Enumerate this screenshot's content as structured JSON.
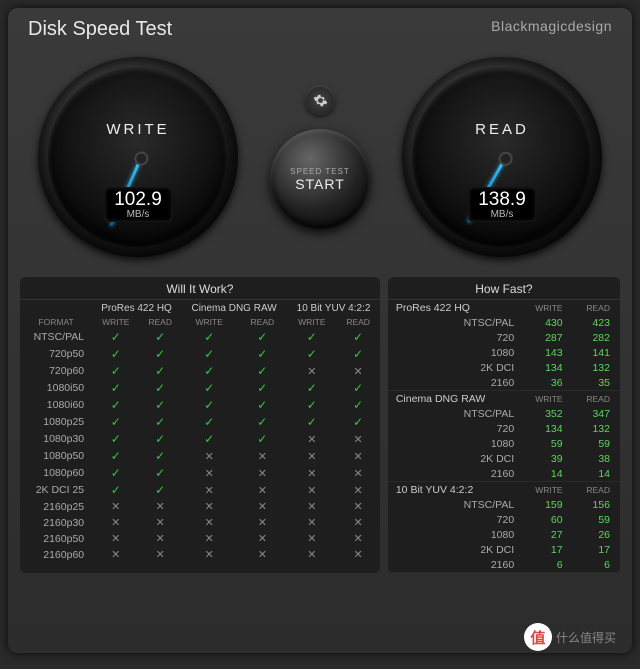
{
  "title": "Disk Speed Test",
  "brand": "Blackmagicdesign",
  "gear_icon": "gear-icon",
  "start": {
    "sub": "SPEED TEST",
    "main": "START"
  },
  "write": {
    "label": "WRITE",
    "value": "102.9",
    "unit": "MB/s",
    "needle_deg": 24
  },
  "read": {
    "label": "READ",
    "value": "138.9",
    "unit": "MB/s",
    "needle_deg": 30
  },
  "will_it_work": {
    "title": "Will It Work?",
    "format_hdr": "FORMAT",
    "codecs": [
      "ProRes 422 HQ",
      "Cinema DNG RAW",
      "10 Bit YUV 4:2:2"
    ],
    "sub": [
      "WRITE",
      "READ"
    ],
    "rows": [
      {
        "fmt": "NTSC/PAL",
        "c": [
          [
            1,
            1
          ],
          [
            1,
            1
          ],
          [
            1,
            1
          ]
        ]
      },
      {
        "fmt": "720p50",
        "c": [
          [
            1,
            1
          ],
          [
            1,
            1
          ],
          [
            1,
            1
          ]
        ]
      },
      {
        "fmt": "720p60",
        "c": [
          [
            1,
            1
          ],
          [
            1,
            1
          ],
          [
            0,
            0
          ]
        ]
      },
      {
        "fmt": "1080i50",
        "c": [
          [
            1,
            1
          ],
          [
            1,
            1
          ],
          [
            1,
            1
          ]
        ]
      },
      {
        "fmt": "1080i60",
        "c": [
          [
            1,
            1
          ],
          [
            1,
            1
          ],
          [
            1,
            1
          ]
        ]
      },
      {
        "fmt": "1080p25",
        "c": [
          [
            1,
            1
          ],
          [
            1,
            1
          ],
          [
            1,
            1
          ]
        ]
      },
      {
        "fmt": "1080p30",
        "c": [
          [
            1,
            1
          ],
          [
            1,
            1
          ],
          [
            0,
            0
          ]
        ]
      },
      {
        "fmt": "1080p50",
        "c": [
          [
            1,
            1
          ],
          [
            0,
            0
          ],
          [
            0,
            0
          ]
        ]
      },
      {
        "fmt": "1080p60",
        "c": [
          [
            1,
            1
          ],
          [
            0,
            0
          ],
          [
            0,
            0
          ]
        ]
      },
      {
        "fmt": "2K DCI 25",
        "c": [
          [
            1,
            1
          ],
          [
            0,
            0
          ],
          [
            0,
            0
          ]
        ]
      },
      {
        "fmt": "2160p25",
        "c": [
          [
            0,
            0
          ],
          [
            0,
            0
          ],
          [
            0,
            0
          ]
        ]
      },
      {
        "fmt": "2160p30",
        "c": [
          [
            0,
            0
          ],
          [
            0,
            0
          ],
          [
            0,
            0
          ]
        ]
      },
      {
        "fmt": "2160p50",
        "c": [
          [
            0,
            0
          ],
          [
            0,
            0
          ],
          [
            0,
            0
          ]
        ]
      },
      {
        "fmt": "2160p60",
        "c": [
          [
            0,
            0
          ],
          [
            0,
            0
          ],
          [
            0,
            0
          ]
        ]
      }
    ]
  },
  "how_fast": {
    "title": "How Fast?",
    "sub": [
      "WRITE",
      "READ"
    ],
    "sections": [
      {
        "name": "ProRes 422 HQ",
        "rows": [
          {
            "fmt": "NTSC/PAL",
            "w": "430",
            "r": "423"
          },
          {
            "fmt": "720",
            "w": "287",
            "r": "282"
          },
          {
            "fmt": "1080",
            "w": "143",
            "r": "141"
          },
          {
            "fmt": "2K DCI",
            "w": "134",
            "r": "132"
          },
          {
            "fmt": "2160",
            "w": "36",
            "r": "35"
          }
        ]
      },
      {
        "name": "Cinema DNG RAW",
        "rows": [
          {
            "fmt": "NTSC/PAL",
            "w": "352",
            "r": "347"
          },
          {
            "fmt": "720",
            "w": "134",
            "r": "132"
          },
          {
            "fmt": "1080",
            "w": "59",
            "r": "59"
          },
          {
            "fmt": "2K DCI",
            "w": "39",
            "r": "38"
          },
          {
            "fmt": "2160",
            "w": "14",
            "r": "14"
          }
        ]
      },
      {
        "name": "10 Bit YUV 4:2:2",
        "rows": [
          {
            "fmt": "NTSC/PAL",
            "w": "159",
            "r": "156"
          },
          {
            "fmt": "720",
            "w": "60",
            "r": "59"
          },
          {
            "fmt": "1080",
            "w": "27",
            "r": "26"
          },
          {
            "fmt": "2K DCI",
            "w": "17",
            "r": "17"
          },
          {
            "fmt": "2160",
            "w": "6",
            "r": "6"
          }
        ]
      }
    ]
  },
  "watermark": "什么值得买"
}
